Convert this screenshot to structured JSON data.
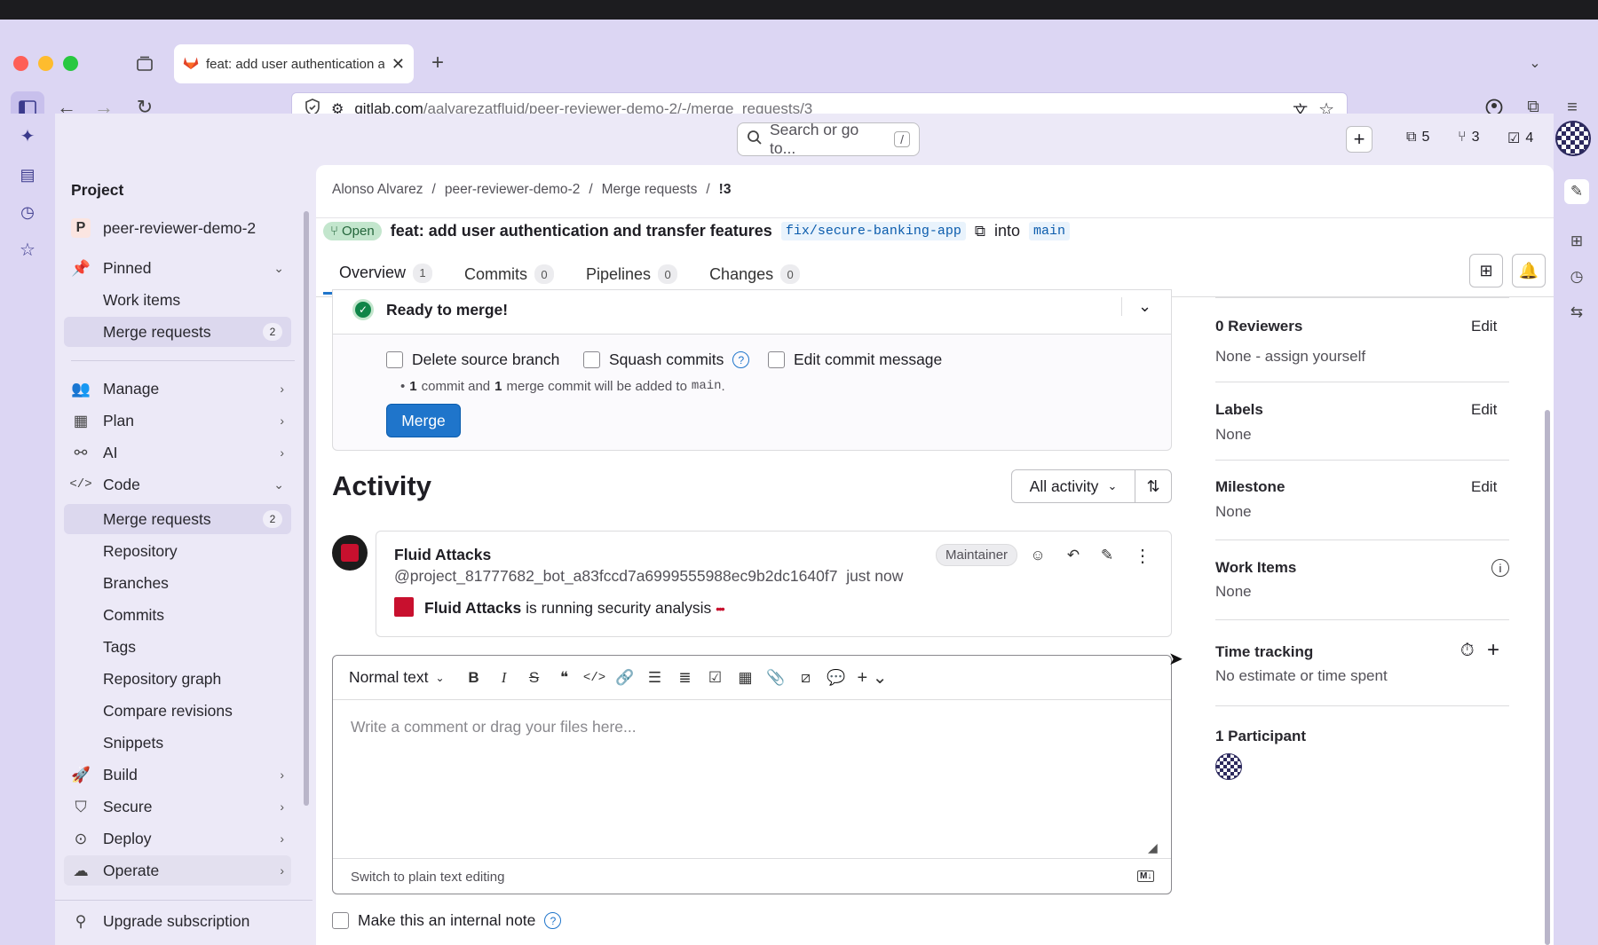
{
  "browser": {
    "tab_title": "feat: add user authentication an",
    "url_host": "gitlab.com",
    "url_path": "/aalvarezatfluid/peer-reviewer-demo-2/-/merge_requests/3"
  },
  "header": {
    "search_placeholder": "Search or go to...",
    "search_shortcut": "/",
    "issues_count": "5",
    "mr_count": "3",
    "todos_count": "4"
  },
  "sidebar": {
    "section_title": "Project",
    "project_initial": "P",
    "project_name": "peer-reviewer-demo-2",
    "pinned": "Pinned",
    "pinned_items": [
      {
        "label": "Work items"
      },
      {
        "label": "Merge requests",
        "badge": "2"
      }
    ],
    "groups": [
      {
        "label": "Manage"
      },
      {
        "label": "Plan"
      },
      {
        "label": "AI"
      },
      {
        "label": "Code"
      }
    ],
    "code_items": [
      {
        "label": "Merge requests",
        "badge": "2"
      },
      {
        "label": "Repository"
      },
      {
        "label": "Branches"
      },
      {
        "label": "Commits"
      },
      {
        "label": "Tags"
      },
      {
        "label": "Repository graph"
      },
      {
        "label": "Compare revisions"
      },
      {
        "label": "Snippets"
      }
    ],
    "groups2": [
      {
        "label": "Build"
      },
      {
        "label": "Secure"
      },
      {
        "label": "Deploy"
      },
      {
        "label": "Operate"
      }
    ],
    "upgrade": "Upgrade subscription"
  },
  "breadcrumb": [
    "Alonso Alvarez",
    "peer-reviewer-demo-2",
    "Merge requests",
    "!3"
  ],
  "mr": {
    "status": "Open",
    "title": "feat: add user authentication and transfer features",
    "source_branch": "fix/secure-banking-app",
    "into": "into",
    "target_branch": "main",
    "tabs": [
      {
        "label": "Overview",
        "count": "1"
      },
      {
        "label": "Commits",
        "count": "0"
      },
      {
        "label": "Pipelines",
        "count": "0"
      },
      {
        "label": "Changes",
        "count": "0"
      }
    ]
  },
  "merge_widget": {
    "ready": "Ready to merge!",
    "delete_source": "Delete source branch",
    "squash": "Squash commits",
    "edit_message": "Edit commit message",
    "info_n1": "1",
    "info_t1": "commit and",
    "info_n2": "1",
    "info_t2": "merge commit will be added to",
    "info_branch": "main",
    "info_end": ".",
    "merge_button": "Merge"
  },
  "activity": {
    "title": "Activity",
    "filter": "All activity",
    "note": {
      "author": "Fluid Attacks",
      "role": "Maintainer",
      "handle": "@project_81777682_bot_a83fccd7a6999555988ec9b2dc1640f7",
      "time": "just now",
      "body_bold": "Fluid Attacks",
      "body_text": "is running security analysis"
    }
  },
  "editor": {
    "format": "Normal text",
    "placeholder": "Write a comment or drag your files here...",
    "switch": "Switch to plain text editing",
    "md_badge": "M↓",
    "internal_note": "Make this an internal note"
  },
  "right_sidebar": {
    "reviewers_label": "0 Reviewers",
    "reviewers_edit": "Edit",
    "reviewers_value": "None - assign yourself",
    "labels_label": "Labels",
    "labels_edit": "Edit",
    "labels_value": "None",
    "milestone_label": "Milestone",
    "milestone_edit": "Edit",
    "milestone_value": "None",
    "work_items_label": "Work Items",
    "work_items_value": "None",
    "time_label": "Time tracking",
    "time_value": "No estimate or time spent",
    "participants_label": "1 Participant"
  },
  "colors": {
    "accent": "#1f75cb",
    "open_green": "#108548",
    "chrome": "#dcd6f3",
    "fluid_red": "#c8102e"
  }
}
